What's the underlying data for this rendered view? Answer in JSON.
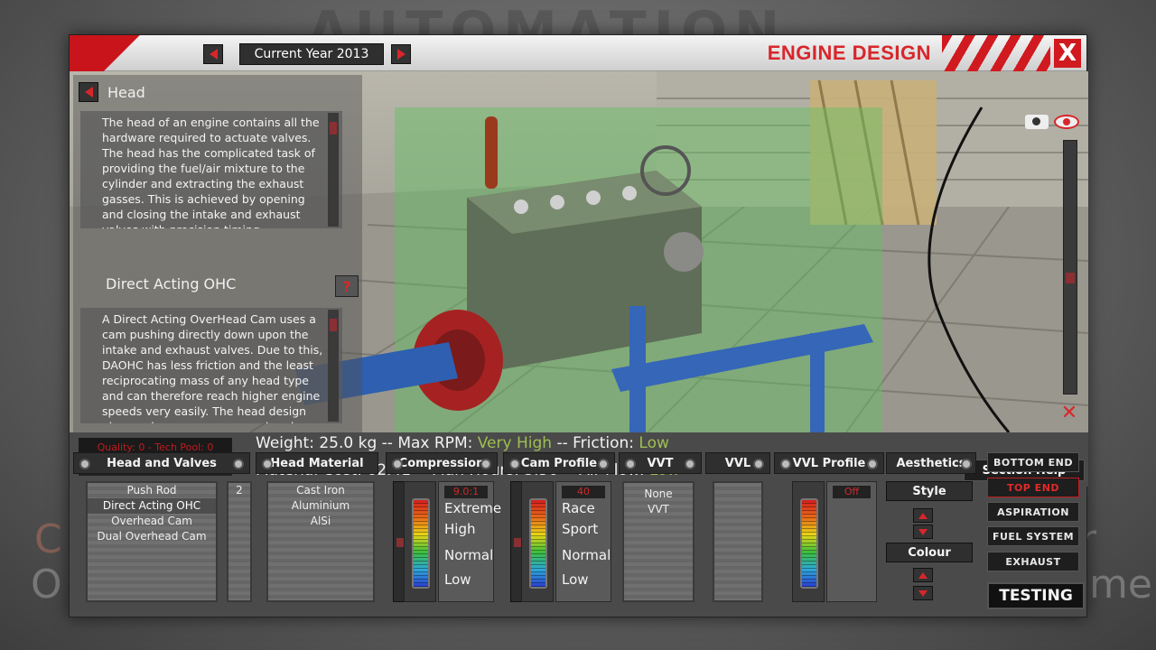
{
  "background": {
    "logo_text": "AUTOMATION",
    "left_fragments": [
      "C",
      "O"
    ],
    "right_fragments": [
      "r",
      "me"
    ]
  },
  "title_bar": {
    "year_label": "Current Year 2013",
    "title": "ENGINE DESIGN",
    "close_label": "X"
  },
  "info": {
    "section_title": "Head",
    "head_description": "The head of an engine contains all the hardware required to actuate valves. The head has the complicated task of providing the fuel/air mixture to the cylinder and extracting the exhaust gasses. This is achieved by opening and closing the intake and exhaust valves with precision timing.",
    "selection_title": "Direct Acting OHC",
    "help_label": "?",
    "selection_description": "A Direct Acting OverHead Cam uses a cam pushing directly down upon the intake and exhaust valves. Due to this, DAOHC has less friction and the least reciprocating mass of any head type and can therefore reach higher engine speeds very easily. The head design also produces a very narrow head, allowing"
  },
  "stats": {
    "quality": "Quality: 0 - Tech Pool: 0",
    "weight_label": "Weight: 25.0 kg -- Max RPM: ",
    "max_rpm": "Very High",
    "friction_label": " -- Friction: ",
    "friction": "Low",
    "cost_label": "Material Cost: 62.41 -- Man Hours: 3.50 -- Air Flow: ",
    "air_flow": "Low",
    "section_help": "Section Help"
  },
  "columns": {
    "head_valves": "Head and Valves",
    "head_material": "Head Material",
    "compression": "Compression",
    "cam_profile": "Cam Profile",
    "vvt": "VVT",
    "vvl": "VVL",
    "vvl_profile": "VVL Profile",
    "aesthetics": "Aesthetics"
  },
  "head_types": [
    "Push Rod",
    "Direct Acting OHC",
    "Overhead Cam",
    "Dual Overhead Cam"
  ],
  "valves_count": "2",
  "materials": [
    "Cast Iron",
    "Aluminium",
    "AlSi"
  ],
  "compression": {
    "value": "9.0:1",
    "levels": [
      "Extreme",
      "High",
      "Normal",
      "Low"
    ]
  },
  "cam": {
    "value": "40",
    "levels": [
      "Race",
      "Sport",
      "Normal",
      "Low"
    ]
  },
  "vvt_options": [
    "None",
    "VVT"
  ],
  "vvl_profile": {
    "value": "Off"
  },
  "aesthetics": {
    "style": "Style",
    "colour": "Colour"
  },
  "nav": {
    "bottom_end": "BOTTOM END",
    "top_end": "TOP END",
    "aspiration": "ASPIRATION",
    "fuel_system": "FUEL SYSTEM",
    "exhaust": "EXHAUST",
    "testing": "TESTING"
  },
  "colors": {
    "accent_red": "#d8262b",
    "highlight_green": "#9dbf52"
  }
}
